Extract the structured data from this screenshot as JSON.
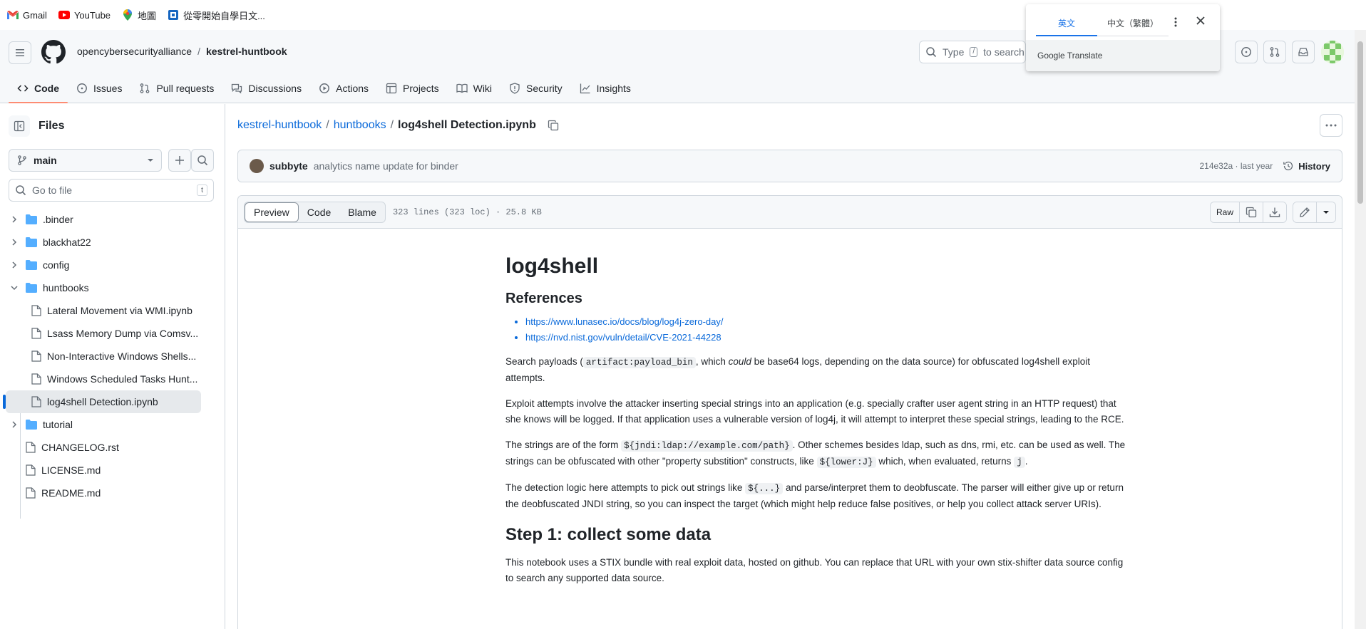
{
  "bookmarks": [
    {
      "label": "Gmail",
      "icon": "gmail-icon"
    },
    {
      "label": "YouTube",
      "icon": "youtube-icon"
    },
    {
      "label": "地圖",
      "icon": "maps-icon"
    },
    {
      "label": "從零開始自學日文...",
      "icon": "bookmark-icon"
    }
  ],
  "header": {
    "owner": "opencybersecurityalliance",
    "separator": "/",
    "repo": "kestrel-huntbook",
    "search_placeholder": "Type",
    "search_key": "/",
    "search_suffix": "to search"
  },
  "repo_nav": [
    {
      "label": "Code",
      "icon": "code-icon",
      "active": true
    },
    {
      "label": "Issues",
      "icon": "issue-icon"
    },
    {
      "label": "Pull requests",
      "icon": "pull-request-icon"
    },
    {
      "label": "Discussions",
      "icon": "discussions-icon"
    },
    {
      "label": "Actions",
      "icon": "actions-icon"
    },
    {
      "label": "Projects",
      "icon": "projects-icon"
    },
    {
      "label": "Wiki",
      "icon": "wiki-icon"
    },
    {
      "label": "Security",
      "icon": "shield-icon"
    },
    {
      "label": "Insights",
      "icon": "graph-icon"
    }
  ],
  "sidebar": {
    "title": "Files",
    "branch": "main",
    "goto_placeholder": "Go to file",
    "goto_key": "t",
    "tree": [
      {
        "label": ".binder",
        "type": "folder",
        "state": "collapsed"
      },
      {
        "label": "blackhat22",
        "type": "folder",
        "state": "collapsed"
      },
      {
        "label": "config",
        "type": "folder",
        "state": "collapsed"
      },
      {
        "label": "huntbooks",
        "type": "folder",
        "state": "expanded"
      },
      {
        "label": "Lateral Movement via WMI.ipynb",
        "type": "file",
        "nested": true
      },
      {
        "label": "Lsass Memory Dump via Comsv...",
        "type": "file",
        "nested": true
      },
      {
        "label": "Non-Interactive Windows Shells...",
        "type": "file",
        "nested": true
      },
      {
        "label": "Windows Scheduled Tasks Hunt...",
        "type": "file",
        "nested": true
      },
      {
        "label": "log4shell Detection.ipynb",
        "type": "file",
        "nested": true,
        "selected": true
      },
      {
        "label": "tutorial",
        "type": "folder",
        "state": "collapsed"
      },
      {
        "label": "CHANGELOG.rst",
        "type": "file"
      },
      {
        "label": "LICENSE.md",
        "type": "file"
      },
      {
        "label": "README.md",
        "type": "file"
      }
    ]
  },
  "main": {
    "path_repo": "kestrel-huntbook",
    "path_dir": "huntbooks",
    "path_sep": "/",
    "path_file": "log4shell Detection.ipynb",
    "commit": {
      "author": "subbyte",
      "message": "analytics name update for binder",
      "meta": "214e32a · last year",
      "history_label": "History"
    },
    "file_tabs": [
      "Preview",
      "Code",
      "Blame"
    ],
    "file_info": "323 lines (323 loc) · 25.8 KB",
    "raw_label": "Raw"
  },
  "article": {
    "h1": "log4shell",
    "h2_refs": "References",
    "links": [
      "https://www.lunasec.io/docs/blog/log4j-zero-day/",
      "https://nvd.nist.gov/vuln/detail/CVE-2021-44228"
    ],
    "p1_a": "Search payloads (",
    "p1_code": "artifact:payload_bin",
    "p1_b": ", which ",
    "p1_em": "could",
    "p1_c": " be base64 logs, depending on the data source) for obfuscated log4shell exploit attempts.",
    "p2": "Exploit attempts involve the attacker inserting special strings into an application (e.g. specially crafter user agent string in an HTTP request) that she knows will be logged. If that application uses a vulnerable version of log4j, it will attempt to interpret these special strings, leading to the RCE.",
    "p3_a": "The strings are of the form ",
    "p3_code1": "${jndi:ldap://example.com/path}",
    "p3_b": ". Other schemes besides ldap, such as dns, rmi, etc. can be used as well. The strings can be obfuscated with other \"property substition\" constructs, like ",
    "p3_code2": "${lower:J}",
    "p3_c": " which, when evaluated, returns ",
    "p3_code3": "j",
    "p3_d": ".",
    "p4_a": "The detection logic here attempts to pick out strings like ",
    "p4_code": "${...}",
    "p4_b": " and parse/interpret them to deobfuscate. The parser will either give up or return the deobfuscated JNDI string, so you can inspect the target (which might help reduce false positives, or help you collect attack server URIs).",
    "h2_step1": "Step 1: collect some data",
    "p5": "This notebook uses a STIX bundle with real exploit data, hosted on github. You can replace that URL with your own stix-shifter data source config to search any supported data source."
  },
  "translate_popup": {
    "tab_english": "英文",
    "tab_chinese": "中文（繁體）",
    "footer": "Google Translate"
  },
  "colors": {
    "link": "#0969da",
    "nav_active": "#fd8c73",
    "folder": "#54aeff",
    "translate_blue": "#1a73e8"
  }
}
